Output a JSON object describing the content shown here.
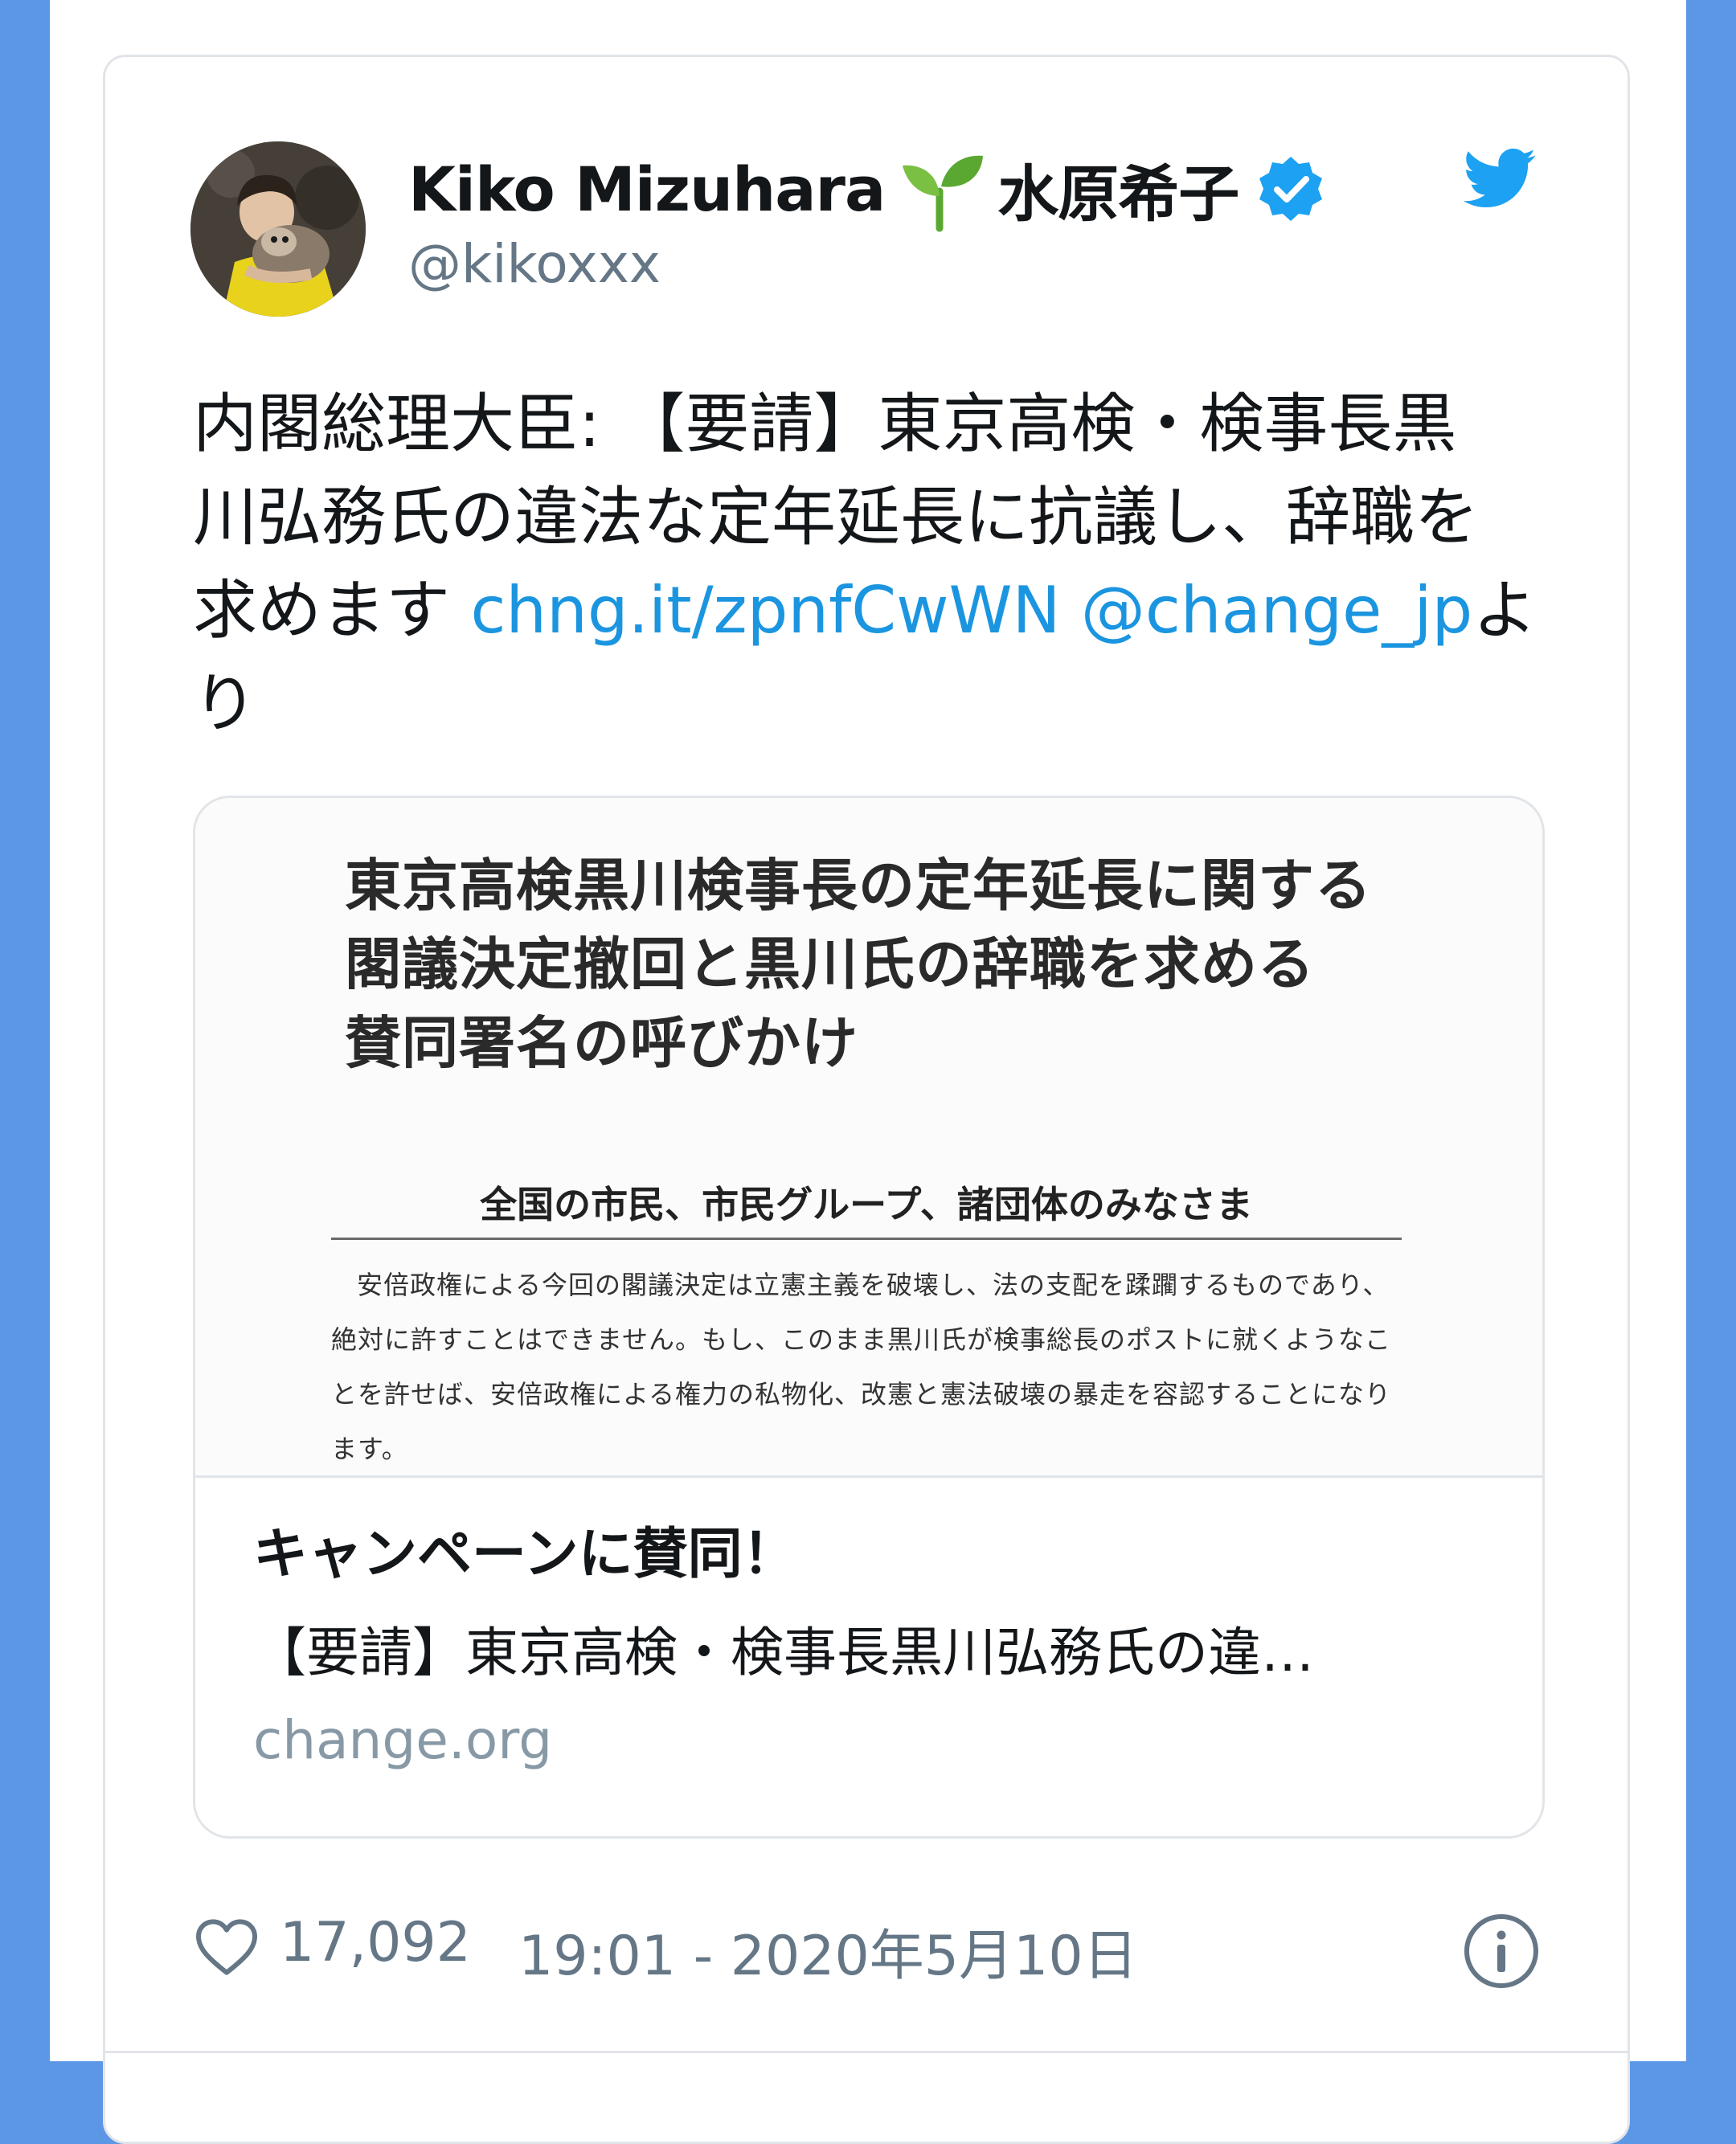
{
  "tweet": {
    "display_name": "Kiko Mizuhara",
    "display_name_jp": "水原希子",
    "handle": "@kikoxxx",
    "text_lines": [
      "内閣総理大臣: 【要請】東京高検・検事長黒",
      "川弘務氏の違法な定年延長に抗議し、辞職を"
    ],
    "text_line3_prefix": "求めます ",
    "link_url": "chng.it/zpnfCwWN",
    "link_mention": "@change_jp",
    "text_line3_suffix": "よ",
    "text_line4": "り"
  },
  "card": {
    "doc_title_lines": [
      "東京高検黒川検事長の定年延長に関する",
      "閣議決定撤回と黒川氏の辞職を求める",
      "賛同署名の呼びかけ"
    ],
    "doc_addressee": "全国の市民、市民グループ、諸団体のみなさま",
    "doc_body": "安倍政権による今回の閣議決定は立憲主義を破壊し、法の支配を蹂躙するものであり、絶対に許すことはできません。もし、このまま黒川氏が検事総長のポストに就くようなことを許せば、安倍政権による権力の私物化、改憲と憲法破壊の暴走を容認することになります。",
    "title": "キャンペーンに賛同！",
    "description": "【要請】東京高検・検事長黒川弘務氏の違…",
    "domain": "change.org"
  },
  "footer": {
    "like_count": "17,092",
    "timestamp": "19:01 - 2020年5月10日"
  },
  "icons": {
    "sprout": "seedling-icon",
    "verified": "verified-badge-icon",
    "bird": "twitter-bird-icon",
    "like": "heart-icon",
    "info": "info-icon"
  },
  "colors": {
    "background_frame": "#5c97e6",
    "link": "#1b95e0",
    "verified": "#1da1f2",
    "muted": "#657786",
    "sprout": "#5aa832"
  }
}
